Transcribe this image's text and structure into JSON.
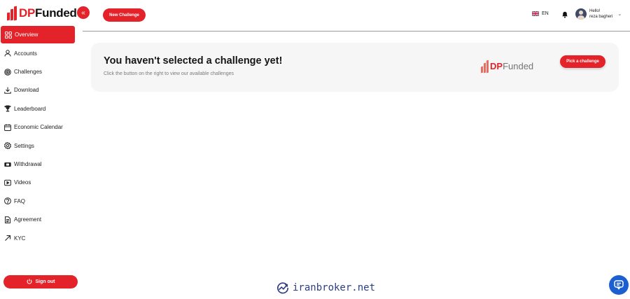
{
  "brand": {
    "dp": "DP",
    "funded": "Funded"
  },
  "collapse_glyph": "«",
  "header": {
    "new_challenge_label": "New Challenge",
    "language": "EN",
    "greeting": "Hello!",
    "user_name": "reza bagheri",
    "chevron": "⌄"
  },
  "sidebar": {
    "items": [
      {
        "label": "Overview",
        "icon": "grid-icon",
        "active": true
      },
      {
        "label": "Accounts",
        "icon": "user-icon"
      },
      {
        "label": "Challenges",
        "icon": "target-icon"
      },
      {
        "label": "Download",
        "icon": "download-icon"
      },
      {
        "label": "Leaderboard",
        "icon": "trophy-icon"
      },
      {
        "label": "Economic Calendar",
        "icon": "calendar-icon"
      },
      {
        "label": "Settings",
        "icon": "gear-icon"
      },
      {
        "label": "Withdrawal",
        "icon": "withdraw-icon"
      },
      {
        "label": "Videos",
        "icon": "video-icon"
      },
      {
        "label": "FAQ",
        "icon": "help-icon"
      },
      {
        "label": "Agreement",
        "icon": "document-icon"
      },
      {
        "label": "KYC",
        "icon": "arrow-icon"
      }
    ],
    "signout_label": "Sign out"
  },
  "main": {
    "title": "You haven't selected a challenge yet!",
    "subtitle": "Click the button on the right to view our available challenges",
    "pick_label": "Pick a challenge"
  },
  "watermark": "iranbroker.net",
  "colors": {
    "accent": "#e3222a",
    "chat": "#1b5fd1",
    "card": "#f6f6f6"
  }
}
